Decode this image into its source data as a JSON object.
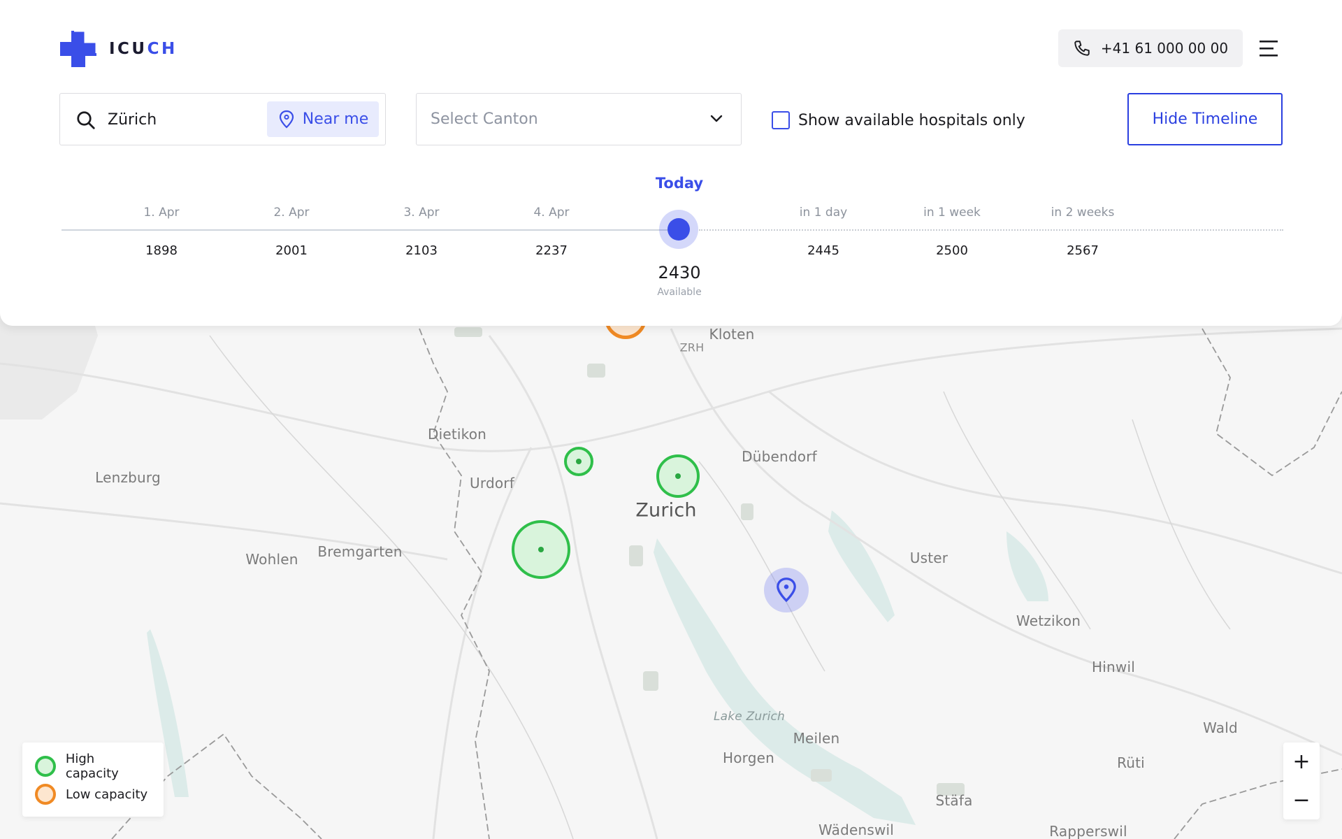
{
  "brand": {
    "name_prefix": "ICU",
    "name_suffix": "CH",
    "accent": "#3a4ee8"
  },
  "header": {
    "phone": "+41 61 000 00 00",
    "search": {
      "value": "Zürich",
      "near_me_label": "Near me"
    },
    "canton": {
      "placeholder": "Select Canton"
    },
    "available_only_label": "Show available hospitals only",
    "hide_timeline_label": "Hide Timeline"
  },
  "timeline": {
    "past": [
      {
        "label": "1. Apr",
        "value": "1898"
      },
      {
        "label": "2. Apr",
        "value": "2001"
      },
      {
        "label": "3. Apr",
        "value": "2103"
      },
      {
        "label": "4. Apr",
        "value": "2237"
      }
    ],
    "today": {
      "label": "Today",
      "value": "2430",
      "sub": "Available"
    },
    "future": [
      {
        "label": "in 1 day",
        "value": "2445"
      },
      {
        "label": "in 1 week",
        "value": "2500"
      },
      {
        "label": "in 2 weeks",
        "value": "2567"
      }
    ]
  },
  "map": {
    "places": {
      "kloten": "Kloten",
      "zrh": "ZRH",
      "dietikon": "Dietikon",
      "dubendorf": "Dübendorf",
      "lenzburg": "Lenzburg",
      "urdorf": "Urdorf",
      "zurich": "Zurich",
      "wohlen": "Wohlen",
      "bremgarten": "Bremgarten",
      "uster": "Uster",
      "wetzikon": "Wetzikon",
      "hinwil": "Hinwil",
      "lake_zurich": "Lake Zurich",
      "meilen": "Meilen",
      "horgen": "Horgen",
      "wald": "Wald",
      "ruti": "Rüti",
      "stafa": "Stäfa",
      "wadenswil": "Wädenswil",
      "rapperswil": "Rapperswil"
    },
    "colors": {
      "high": "#2fbf4a",
      "low": "#f08a24",
      "location": "#3a4ee8"
    }
  },
  "legend": {
    "high_label": "High capacity",
    "low_label": "Low capacity"
  },
  "zoom": {
    "in_label": "+",
    "out_label": "−"
  }
}
